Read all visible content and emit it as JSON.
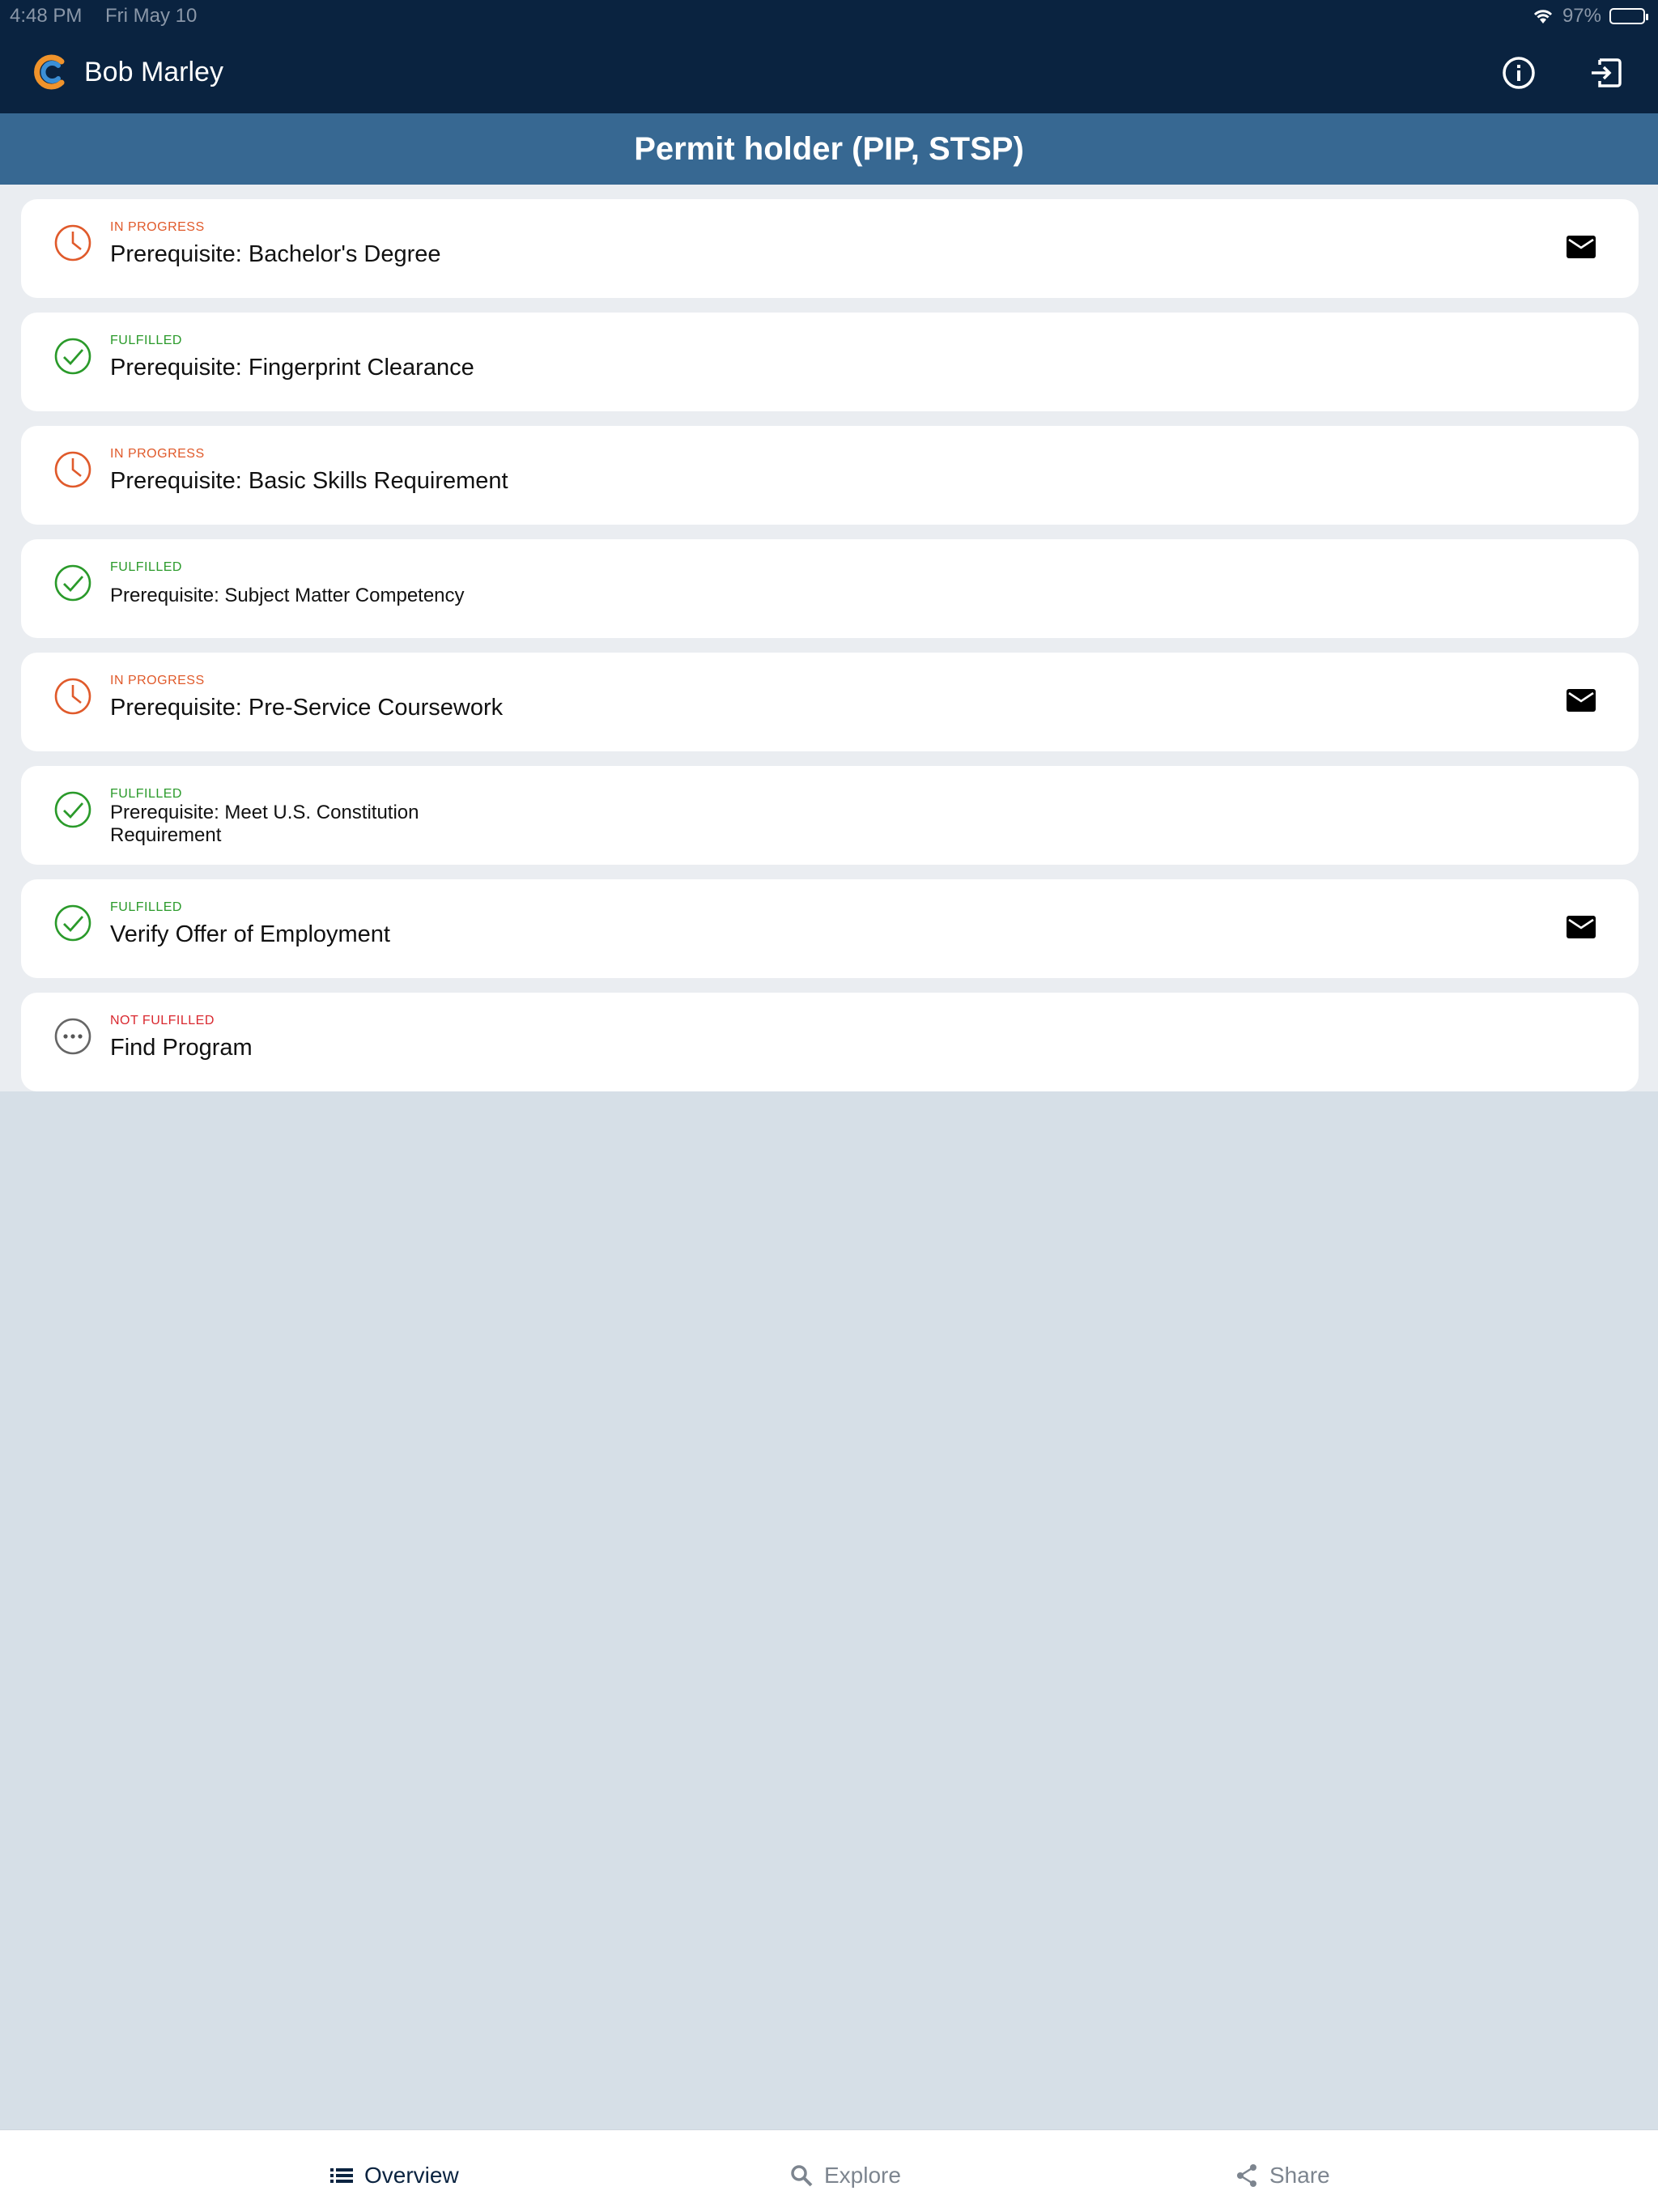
{
  "status_bar": {
    "time": "4:48 PM",
    "date": "Fri May 10",
    "battery": "97%"
  },
  "app_bar": {
    "user_name": "Bob Marley"
  },
  "page": {
    "title": "Permit holder (PIP, STSP)"
  },
  "colors": {
    "in_progress": "#e05a2b",
    "fulfilled": "#2a9a2a",
    "not_fulfilled": "#d9282f",
    "navy": "#0a2340",
    "banner": "#376892"
  },
  "items": [
    {
      "status": "IN PROGRESS",
      "status_key": "in_progress",
      "title": "Prerequisite: Bachelor's Degree",
      "has_mail": true
    },
    {
      "status": "FULFILLED",
      "status_key": "fulfilled",
      "title": "Prerequisite: Fingerprint Clearance",
      "has_mail": false
    },
    {
      "status": "IN PROGRESS",
      "status_key": "in_progress",
      "title": "Prerequisite: Basic Skills Requirement",
      "has_mail": false
    },
    {
      "status": "FULFILLED",
      "status_key": "fulfilled",
      "title": "Prerequisite: Subject Matter Competency",
      "has_mail": false
    },
    {
      "status": "IN PROGRESS",
      "status_key": "in_progress",
      "title": "Prerequisite: Pre-Service Coursework",
      "has_mail": true
    },
    {
      "status": "FULFILLED",
      "status_key": "fulfilled",
      "title": "Prerequisite: Meet U.S. Constitution Requirement",
      "has_mail": false
    },
    {
      "status": "FULFILLED",
      "status_key": "fulfilled",
      "title": "Verify Offer of Employment",
      "has_mail": true
    },
    {
      "status": "NOT FULFILLED",
      "status_key": "not_fulfilled",
      "title": "Find Program",
      "has_mail": false
    }
  ],
  "tabs": [
    {
      "label": "Overview",
      "icon": "list-icon",
      "active": true
    },
    {
      "label": "Explore",
      "icon": "search-icon",
      "active": false
    },
    {
      "label": "Share",
      "icon": "share-icon",
      "active": false
    }
  ]
}
